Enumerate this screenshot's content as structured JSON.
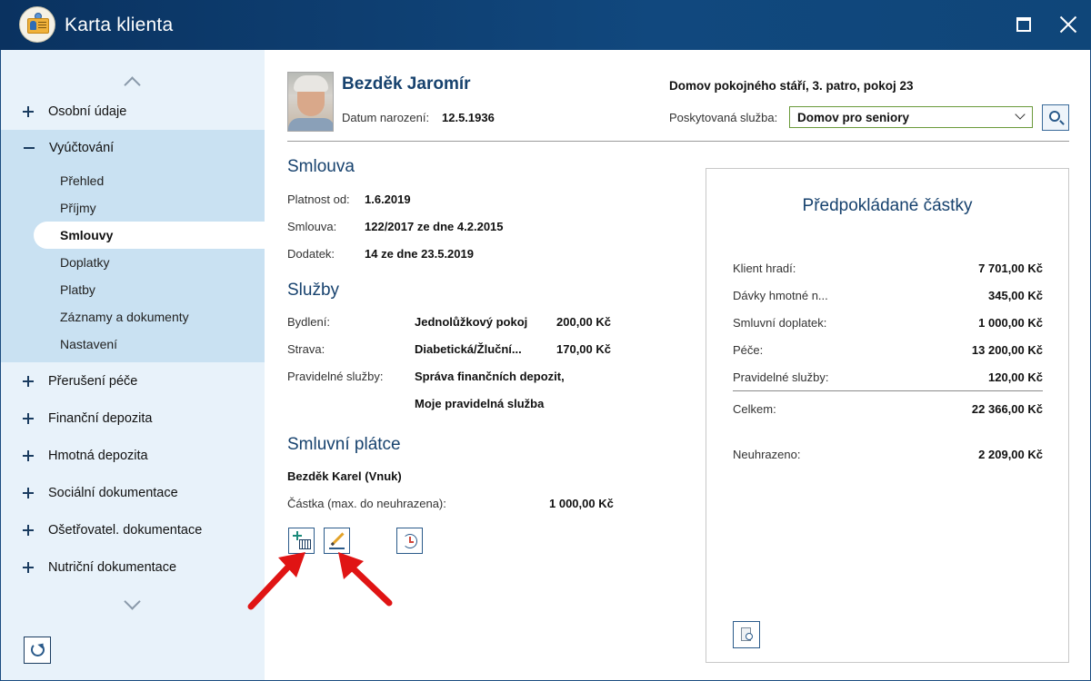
{
  "window": {
    "title": "Karta klienta"
  },
  "sidebar": {
    "top_items": [
      {
        "label": "Osobní údaje"
      },
      {
        "label": "Vyúčtování"
      }
    ],
    "sub_items": [
      {
        "label": "Přehled"
      },
      {
        "label": "Příjmy"
      },
      {
        "label": "Smlouvy"
      },
      {
        "label": "Doplatky"
      },
      {
        "label": "Platby"
      },
      {
        "label": "Záznamy a dokumenty"
      },
      {
        "label": "Nastavení"
      }
    ],
    "bottom_items": [
      {
        "label": "Přerušení péče"
      },
      {
        "label": "Finanční depozita"
      },
      {
        "label": "Hmotná depozita"
      },
      {
        "label": "Sociální dokumentace"
      },
      {
        "label": "Ošetřovatel. dokumentace"
      },
      {
        "label": "Nutriční dokumentace"
      }
    ],
    "active_sub_item": "Smlouvy"
  },
  "client": {
    "name": "Bezděk Jaromír",
    "dob_label": "Datum narození:",
    "dob": "12.5.1936",
    "location": "Domov pokojného stáří, 3. patro, pokoj 23",
    "service_label": "Poskytovaná služba:",
    "service_value": "Domov pro seniory"
  },
  "contract": {
    "title": "Smlouva",
    "rows": [
      {
        "label": "Platnost od:",
        "value": "1.6.2019"
      },
      {
        "label": "Smlouva:",
        "value": "122/2017 ze dne 4.2.2015"
      },
      {
        "label": "Dodatek:",
        "value": "14 ze dne 23.5.2019"
      }
    ]
  },
  "services": {
    "title": "Služby",
    "rows": [
      {
        "label": "Bydlení:",
        "value": "Jednolůžkový pokoj",
        "amount": "200,00 Kč"
      },
      {
        "label": "Strava:",
        "value": "Diabetická/Žluční...",
        "amount": "170,00 Kč"
      },
      {
        "label": "Pravidelné služby:",
        "value": "Správa finančních depozit,",
        "amount": ""
      },
      {
        "label": "",
        "value": "Moje pravidelná služba",
        "amount": ""
      }
    ]
  },
  "payer": {
    "title": "Smluvní plátce",
    "name": "Bezděk Karel (Vnuk)",
    "amount_label": "Částka (max. do neuhrazena):",
    "amount": "1 000,00 Kč"
  },
  "panel": {
    "title": "Předpokládané částky",
    "rows": [
      {
        "label": "Klient hradí:",
        "value": "7 701,00 Kč"
      },
      {
        "label": "Dávky hmotné n...",
        "value": "345,00 Kč"
      },
      {
        "label": "Smluvní doplatek:",
        "value": "1 000,00 Kč"
      },
      {
        "label": "Péče:",
        "value": "13 200,00 Kč"
      },
      {
        "label": "Pravidelné služby:",
        "value": "120,00 Kč"
      }
    ],
    "total": {
      "label": "Celkem:",
      "value": "22 366,00 Kč"
    },
    "unpaid": {
      "label": "Neuhrazeno:",
      "value": "2 209,00 Kč"
    }
  },
  "icons": {
    "app": "client-card-icon",
    "maximize": "maximize-icon",
    "close": "close-icon",
    "scroll_up": "chevron-up-icon",
    "scroll_down": "chevron-down-icon",
    "refresh": "refresh-icon",
    "search": "search-icon",
    "add": "add-calendar-icon",
    "edit": "edit-pencil-icon",
    "history": "history-icon",
    "preview": "document-preview-icon"
  },
  "colors": {
    "titlebar": "#11487e",
    "accent_text": "#17426e",
    "sidebar_bg": "#e8f2fa",
    "sidebar_open_bg": "#c9e1f2",
    "arrow": "#e01414"
  }
}
